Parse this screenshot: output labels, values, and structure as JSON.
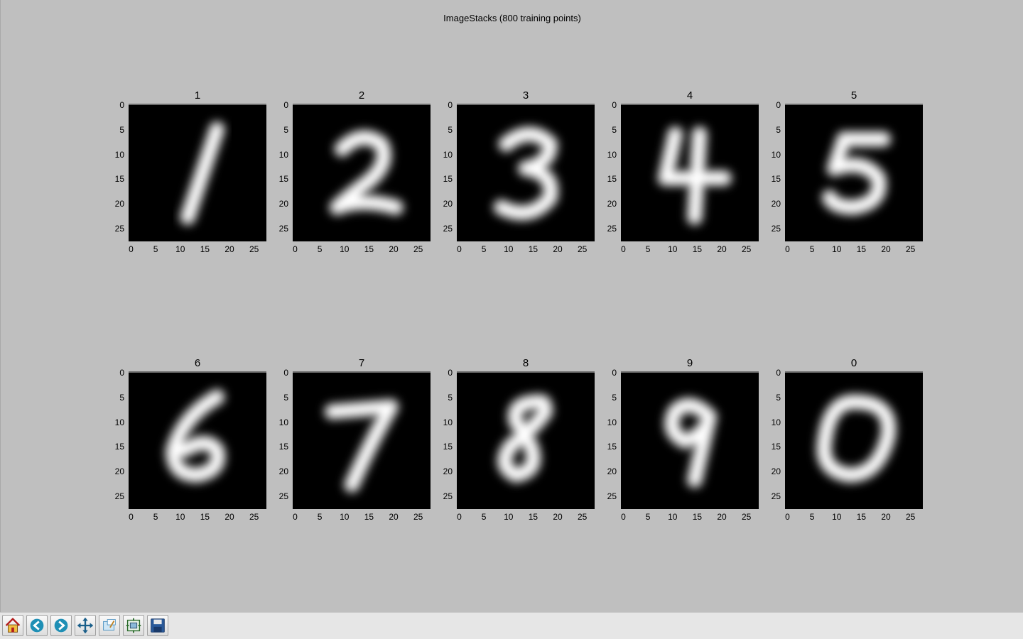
{
  "figure": {
    "suptitle": "ImageStacks (800 training points)"
  },
  "subplots": [
    {
      "title": "1"
    },
    {
      "title": "2"
    },
    {
      "title": "3"
    },
    {
      "title": "4"
    },
    {
      "title": "5"
    },
    {
      "title": "6"
    },
    {
      "title": "7"
    },
    {
      "title": "8"
    },
    {
      "title": "9"
    },
    {
      "title": "0"
    }
  ],
  "axes": {
    "yticks": [
      "0",
      "5",
      "10",
      "15",
      "20",
      "25"
    ],
    "xticks": [
      "0",
      "5",
      "10",
      "15",
      "20",
      "25"
    ]
  },
  "toolbar": {
    "buttons": [
      {
        "name": "home-button",
        "icon": "home-icon"
      },
      {
        "name": "back-button",
        "icon": "back-arrow-icon"
      },
      {
        "name": "forward-button",
        "icon": "forward-arrow-icon"
      },
      {
        "name": "pan-button",
        "icon": "pan-arrows-icon"
      },
      {
        "name": "zoom-button",
        "icon": "zoom-rect-icon"
      },
      {
        "name": "subplots-button",
        "icon": "subplots-config-icon"
      },
      {
        "name": "save-button",
        "icon": "floppy-disk-icon"
      }
    ]
  },
  "colors": {
    "figure_bg": "#bfbfbf",
    "image_bg": "#000000",
    "digit_stroke": "#ffffff",
    "toolbar_bg": "#e6e6e6"
  }
}
